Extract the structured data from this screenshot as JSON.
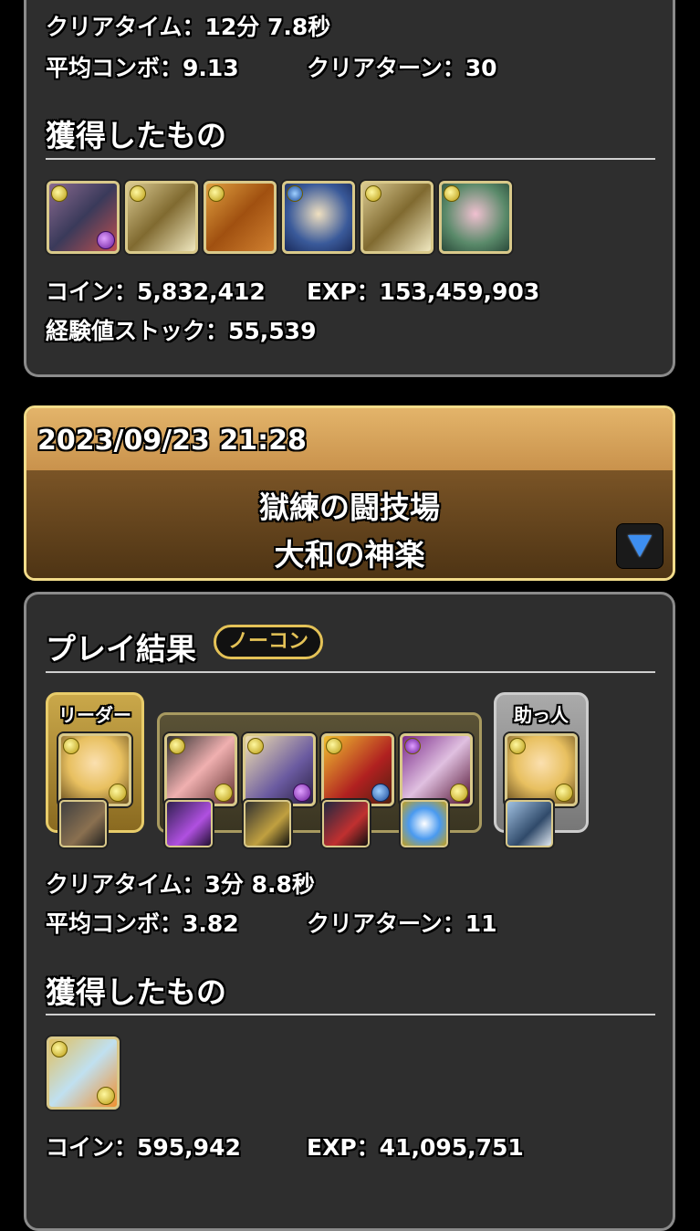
{
  "top_result": {
    "clear_time": "クリアタイム：12分 7.8秒",
    "avg_combo": "平均コンボ：9.13",
    "clear_turns": "クリアターン：30",
    "obtained_title": "獲得したもの",
    "items": [
      {
        "icon": "monster-icon-multicolor-dragon"
      },
      {
        "icon": "monster-icon-angel-trumpet"
      },
      {
        "icon": "monster-icon-golden-dragon"
      },
      {
        "icon": "monster-icon-blue-orb-hero"
      },
      {
        "icon": "monster-icon-angel-trumpet"
      },
      {
        "icon": "monster-icon-pink-orb-girl"
      }
    ],
    "coins": "コイン：5,832,412",
    "exp": "EXP：153,459,903",
    "exp_stock": "経験値ストック：55,539"
  },
  "date_header": {
    "datetime": "2023/09/23 21:28",
    "dungeon_line1": "獄練の闘技場",
    "dungeon_line2": "大和の神楽",
    "expand_icon": "triangle-down-icon"
  },
  "bottom_result": {
    "play_result_title": "プレイ結果",
    "no_continue_badge": "ノーコン",
    "leader_label": "リーダー",
    "helper_label": "助っ人",
    "clear_time": "クリアタイム：3分 8.8秒",
    "avg_combo": "平均コンボ：3.82",
    "clear_turns": "クリアターン：11",
    "obtained_title": "獲得したもの",
    "coins": "コイン：595,942",
    "exp": "EXP：41,095,751"
  },
  "colors": {
    "panel_bg": "#2e2e2e",
    "panel_border": "#8b8b8b",
    "gold": "#e4c257",
    "header_band": "#d6a45a"
  }
}
